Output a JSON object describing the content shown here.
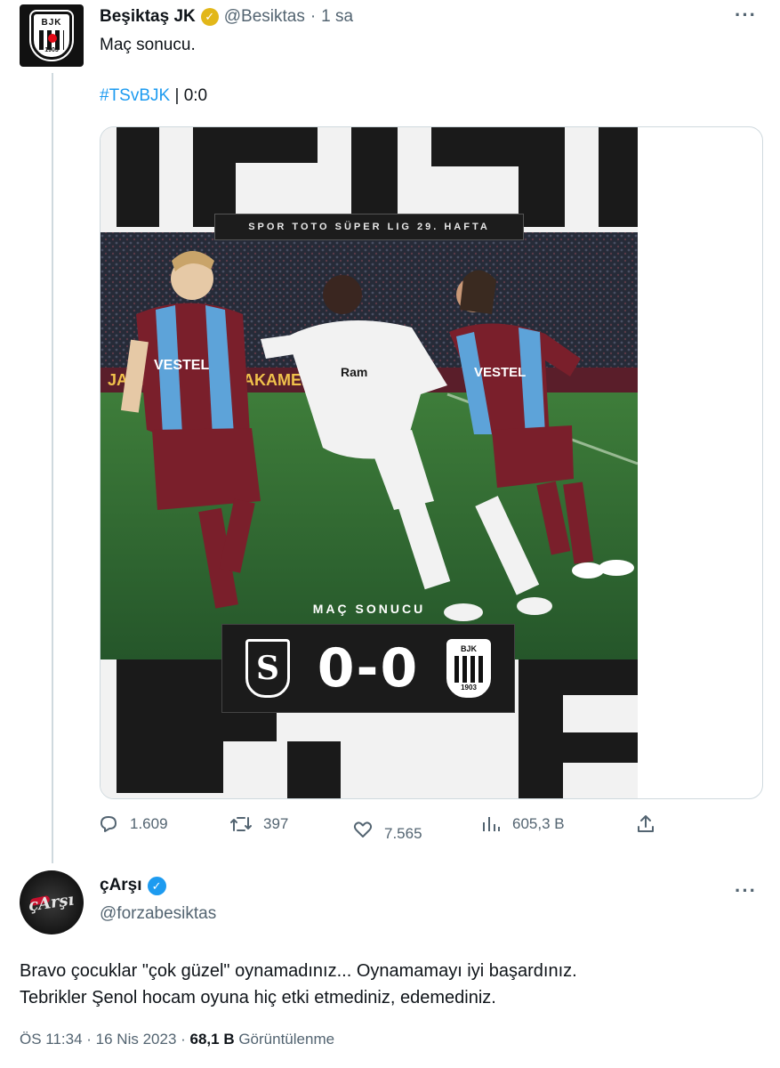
{
  "tweet": {
    "author_name": "Beşiktaş JK",
    "author_handle": "@Besiktas",
    "separator": "·",
    "time_ago": "1 sa",
    "text_line1": "Maç sonucu.",
    "hashtag": "#TSvBJK",
    "score_suffix": " | 0:0",
    "media": {
      "league_label": "SPOR TOTO SÜPER LIG 29. HAFTA",
      "result_label": "MAÇ SONUCU",
      "score": "0-0",
      "home_logo_letter": "S",
      "away_logo_text": "BJK",
      "away_logo_year": "1903",
      "sponsor_text": "VESTEL"
    },
    "stats": {
      "replies": "1.609",
      "retweets": "397",
      "likes": "7.565",
      "views": "605,3 B"
    }
  },
  "reply": {
    "author_name": "çArşı",
    "author_handle": "@forzabesiktas",
    "avatar_text": "çArşı",
    "text_line1": "Bravo çocuklar \"çok güzel\" oynamadınız...  Oynamamayı iyi başardınız.",
    "text_line2": "Tebrikler Şenol hocam oyuna hiç etki etmediniz, edemediniz.",
    "timestamp": "ÖS 11:34 · 16 Nis 2023 · ",
    "views_count": "68,1 B",
    "views_label": " Görüntülenme"
  },
  "icons": {
    "more": "more-dots-icon",
    "reply": "reply-icon",
    "retweet": "retweet-icon",
    "like": "heart-icon",
    "views": "views-chart-icon",
    "share": "share-icon",
    "verified": "verified-badge-icon"
  },
  "colors": {
    "text": "#0f1419",
    "secondary": "#536471",
    "link": "#1d9bf0",
    "gold_badge": "#e2b719",
    "blue_badge": "#1d9bf0",
    "trabzon_claret": "#7a1f2b",
    "trabzon_blue": "#5da3d9",
    "pitch": "#2f6b33"
  }
}
